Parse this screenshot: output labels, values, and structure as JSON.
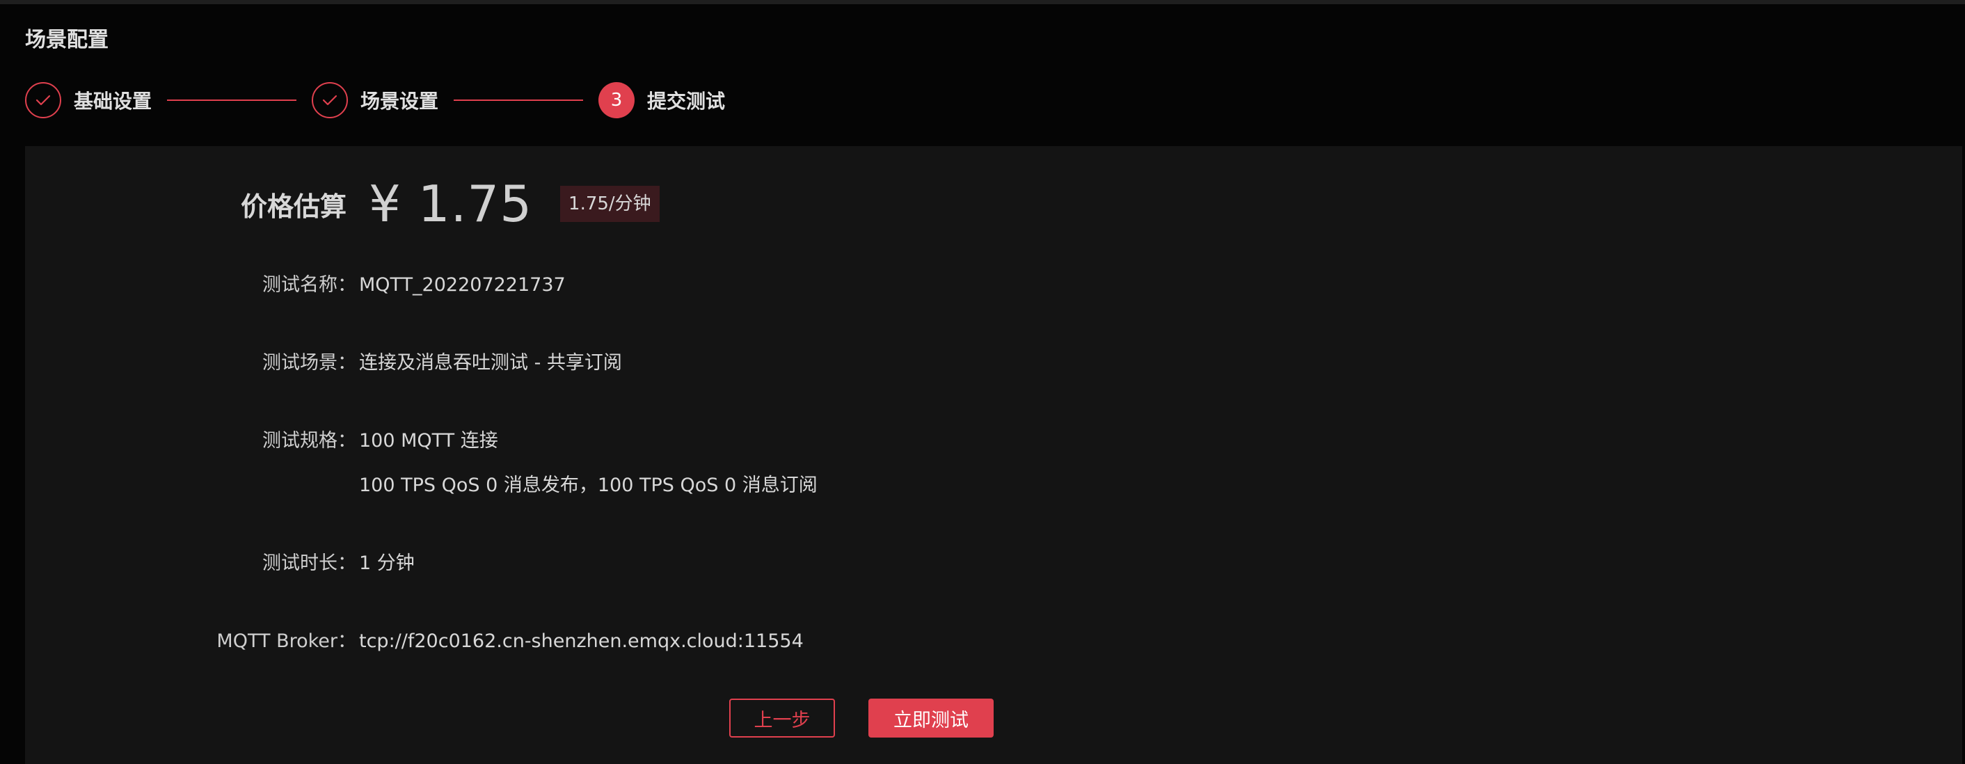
{
  "page": {
    "title": "场景配置"
  },
  "steps": [
    {
      "label": "基础设置",
      "state": "done",
      "icon": "check-icon"
    },
    {
      "label": "场景设置",
      "state": "done",
      "icon": "check-icon"
    },
    {
      "label": "提交测试",
      "state": "active",
      "number": "3"
    }
  ],
  "price": {
    "label": "价格估算",
    "amount": "¥ 1.75",
    "per_minute": "1.75/分钟"
  },
  "details": {
    "name_label": "测试名称：",
    "name_value": "MQTT_202207221737",
    "scene_label": "测试场景：",
    "scene_value": "连接及消息吞吐测试 - 共享订阅",
    "spec_label": "测试规格：",
    "spec_line1": "100 MQTT 连接",
    "spec_line2": "100 TPS QoS 0 消息发布，100 TPS QoS 0 消息订阅",
    "duration_label": "测试时长：",
    "duration_value": "1 分钟",
    "broker_label": "MQTT Broker：",
    "broker_value": "tcp://f20c0162.cn-shenzhen.emqx.cloud:11554"
  },
  "actions": {
    "prev_label": "上一步",
    "submit_label": "立即测试"
  },
  "colors": {
    "accent": "#e0404e",
    "background": "#050505",
    "panel": "#141414"
  }
}
